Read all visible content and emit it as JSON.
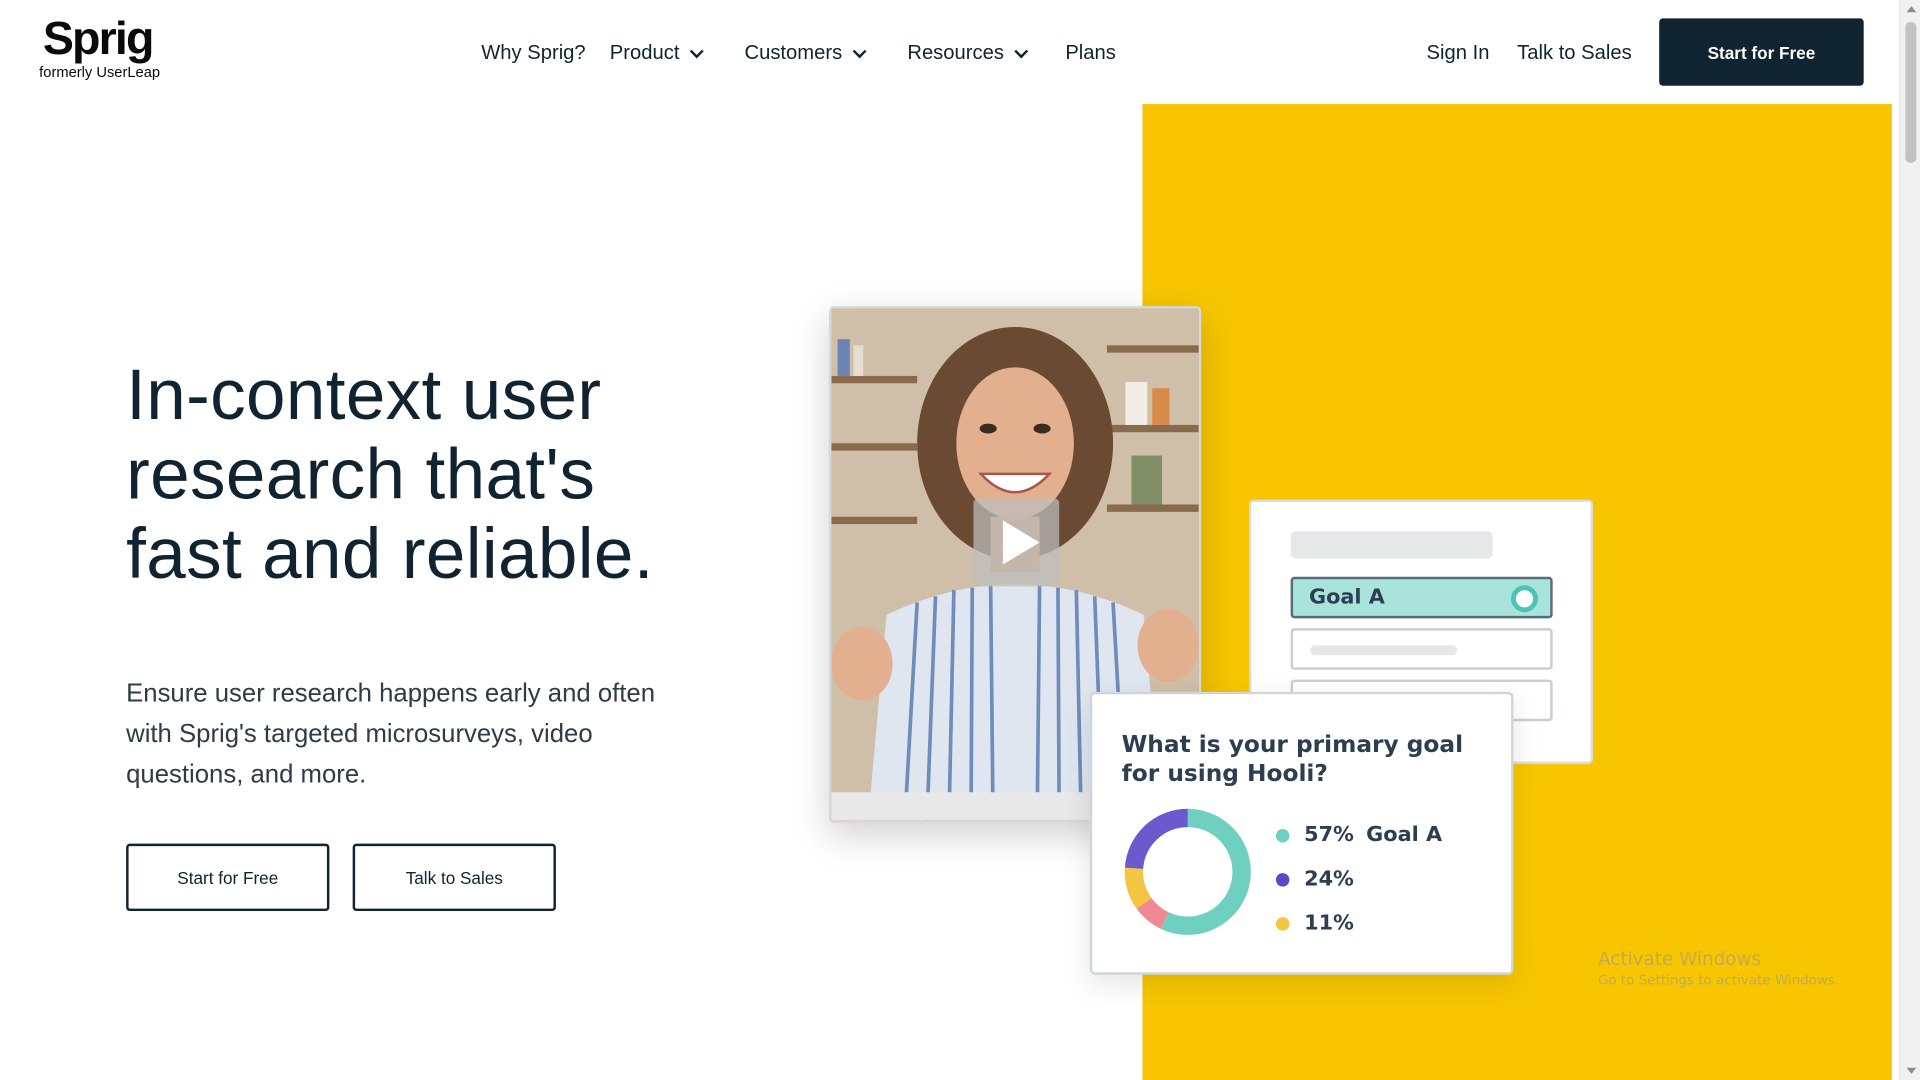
{
  "header": {
    "logo_text": "Sprig",
    "logo_subtext": "formerly UserLeap",
    "nav": [
      {
        "label": "Why Sprig?",
        "has_dropdown": false
      },
      {
        "label": "Product",
        "has_dropdown": true
      },
      {
        "label": "Customers",
        "has_dropdown": true
      },
      {
        "label": "Resources",
        "has_dropdown": true
      },
      {
        "label": "Plans",
        "has_dropdown": false
      }
    ],
    "sign_in": "Sign In",
    "talk_to_sales": "Talk to Sales",
    "cta": "Start for Free"
  },
  "hero": {
    "title_lines": [
      "In-context user",
      "research that's",
      "fast and reliable."
    ],
    "subtitle": "Ensure user research happens early and often with Sprig's targeted microsurveys, video questions, and more.",
    "primary_button": "Start for Free",
    "secondary_button": "Talk to Sales"
  },
  "survey_card": {
    "selected_option": "Goal A"
  },
  "results_card": {
    "question": "What is your primary goal for using Hooli?",
    "donut": [
      {
        "value": 57,
        "color": "#6fcfc0"
      },
      {
        "value": 8,
        "color": "#ef8a94"
      },
      {
        "value": 11,
        "color": "#f4c542"
      },
      {
        "value": 24,
        "color": "#6a5acd"
      }
    ],
    "legend": [
      {
        "pct": "57%",
        "name": "Goal A",
        "color": "#6fcfc0"
      },
      {
        "pct": "24%",
        "name": "",
        "color": "#5b47c8"
      },
      {
        "pct": "11%",
        "name": "",
        "color": "#f4c542"
      }
    ]
  },
  "colors": {
    "brand_dark": "#0f2330",
    "accent_yellow": "#f7c600",
    "teal": "#6fcfc0"
  },
  "watermark": {
    "title": "Activate Windows",
    "subtitle": "Go to Settings to activate Windows."
  }
}
